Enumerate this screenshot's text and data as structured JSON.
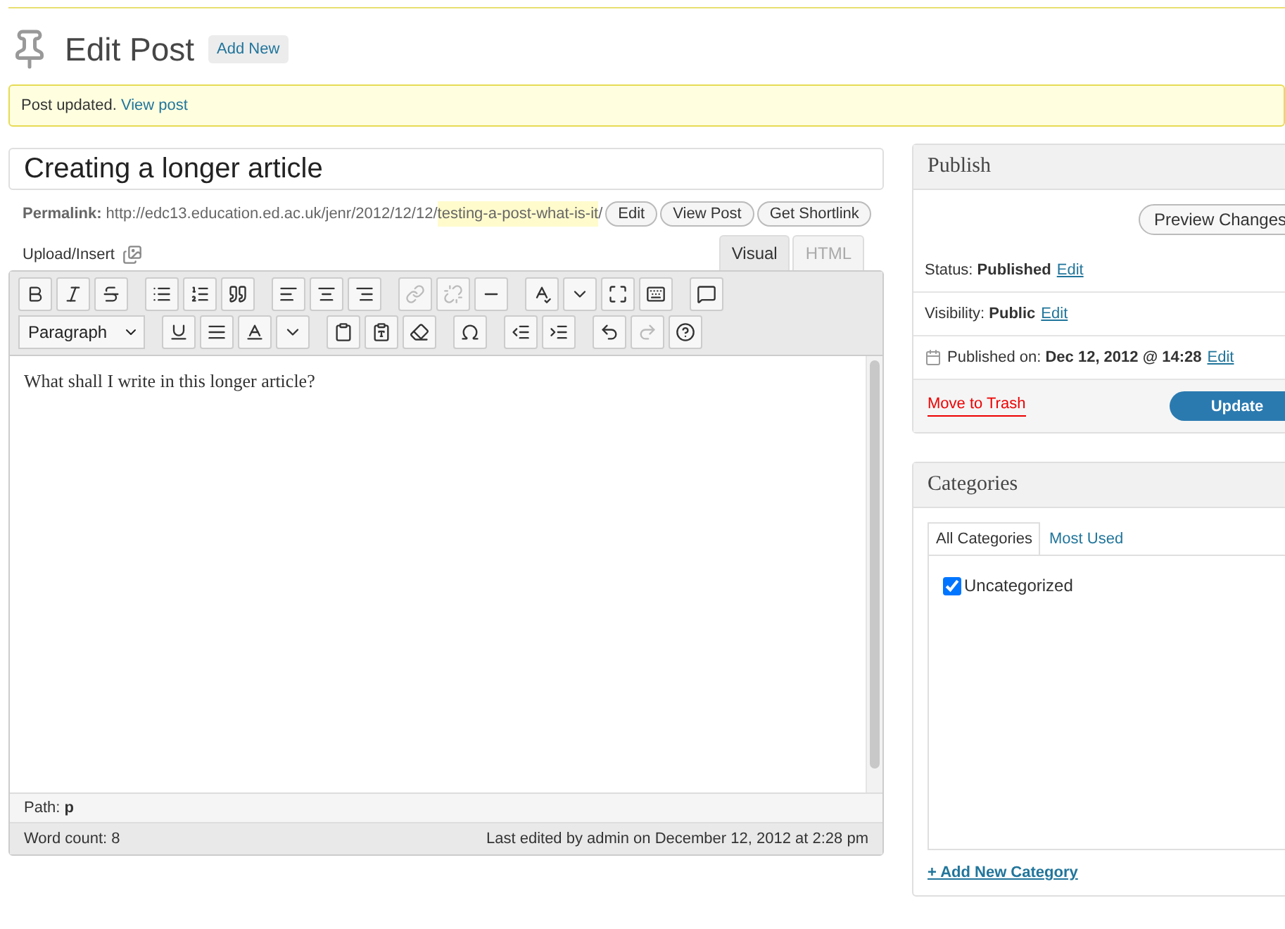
{
  "header": {
    "title": "Edit Post",
    "add_new": "Add New"
  },
  "notice": {
    "text": "Post updated.",
    "link": "View post"
  },
  "post": {
    "title": "Creating a longer article",
    "permalink": {
      "prefix": "**Permalink:** http://edc13.education.ed.ac.uk/jenr/2012/12/12/",
      "slug": "testing-a-post-what-is-it",
      "suffix": "/"
    },
    "permalink_buttons": [
      "Edit",
      "View Post",
      "Get Shortlink"
    ]
  },
  "editor": {
    "upload_label": "Upload/Insert",
    "tabs": [
      {
        "label": "Visual",
        "selected": true
      },
      {
        "label": "HTML",
        "selected": false
      }
    ],
    "format_select": "Paragraph",
    "content": "What shall I write in this longer article?",
    "path_label": "Path:",
    "path_value": "p",
    "word_count": "Word count: 8",
    "last_edited": "Last edited by admin on December 12, 2012 at 2:28 pm"
  },
  "publish": {
    "title": "Publish",
    "preview": "Preview Changes",
    "rows": [
      {
        "text": "Status: **Published**",
        "link": "Edit",
        "kind": "plain"
      },
      {
        "text": "Visibility: **Public**",
        "link": "Edit",
        "kind": "plain"
      },
      {
        "text": "Published on: **Dec 12, 2012 @ 14:28**",
        "link": "Edit",
        "kind": "date"
      }
    ],
    "trash": "Move to Trash",
    "update": "Update"
  },
  "categories": {
    "title": "Categories",
    "tabs": [
      {
        "label": "All Categories",
        "selected": true
      },
      {
        "label": "Most Used",
        "selected": false
      }
    ],
    "items": [
      {
        "label": "Uncategorized",
        "checked": true
      }
    ],
    "add_new": "+ Add New Category"
  }
}
